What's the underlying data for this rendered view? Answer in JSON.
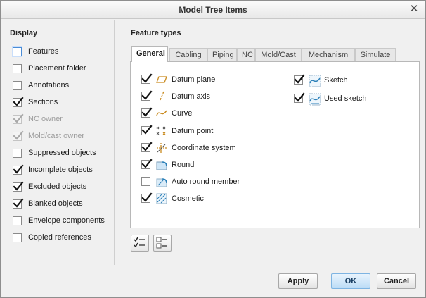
{
  "window": {
    "title": "Model Tree Items",
    "close_glyph": "✕"
  },
  "display": {
    "heading": "Display",
    "items": [
      {
        "label": "Features",
        "checked": false,
        "disabled": false,
        "focused": true
      },
      {
        "label": "Placement folder",
        "checked": false,
        "disabled": false
      },
      {
        "label": "Annotations",
        "checked": false,
        "disabled": false
      },
      {
        "label": "Sections",
        "checked": true,
        "disabled": false
      },
      {
        "label": "NC owner",
        "checked": true,
        "disabled": true
      },
      {
        "label": "Mold/cast owner",
        "checked": true,
        "disabled": true
      },
      {
        "label": "Suppressed objects",
        "checked": false,
        "disabled": false
      },
      {
        "label": "Incomplete objects",
        "checked": true,
        "disabled": false
      },
      {
        "label": "Excluded objects",
        "checked": true,
        "disabled": false
      },
      {
        "label": "Blanked objects",
        "checked": true,
        "disabled": false
      },
      {
        "label": "Envelope components",
        "checked": false,
        "disabled": false
      },
      {
        "label": "Copied references",
        "checked": false,
        "disabled": false
      }
    ]
  },
  "feature_types": {
    "heading": "Feature types",
    "tabs": [
      "General",
      "Cabling",
      "Piping",
      "NC",
      "Mold/Cast",
      "Mechanism",
      "Simulate"
    ],
    "active_tab": "General",
    "left_column": [
      {
        "label": "Datum plane",
        "checked": true,
        "icon": "datum-plane-icon"
      },
      {
        "label": "Datum axis",
        "checked": true,
        "icon": "datum-axis-icon"
      },
      {
        "label": "Curve",
        "checked": true,
        "icon": "curve-icon"
      },
      {
        "label": "Datum point",
        "checked": true,
        "icon": "datum-point-icon"
      },
      {
        "label": "Coordinate system",
        "checked": true,
        "icon": "coordinate-system-icon"
      },
      {
        "label": "Round",
        "checked": true,
        "icon": "round-icon"
      },
      {
        "label": "Auto round member",
        "checked": false,
        "icon": "auto-round-icon"
      },
      {
        "label": "Cosmetic",
        "checked": true,
        "icon": "cosmetic-icon"
      }
    ],
    "right_column": [
      {
        "label": "Sketch",
        "checked": true,
        "icon": "sketch-icon"
      },
      {
        "label": "Used sketch",
        "checked": true,
        "icon": "used-sketch-icon"
      }
    ],
    "select_all_icon": "select-all-icon",
    "clear_all_icon": "clear-all-icon"
  },
  "footer": {
    "apply_label": "Apply",
    "ok_label": "OK",
    "cancel_label": "Cancel"
  },
  "colors": {
    "accent": "#7eb4e2",
    "check": "#111111",
    "icon_orange": "#c98a1e",
    "icon_blue": "#2a7fb8"
  }
}
